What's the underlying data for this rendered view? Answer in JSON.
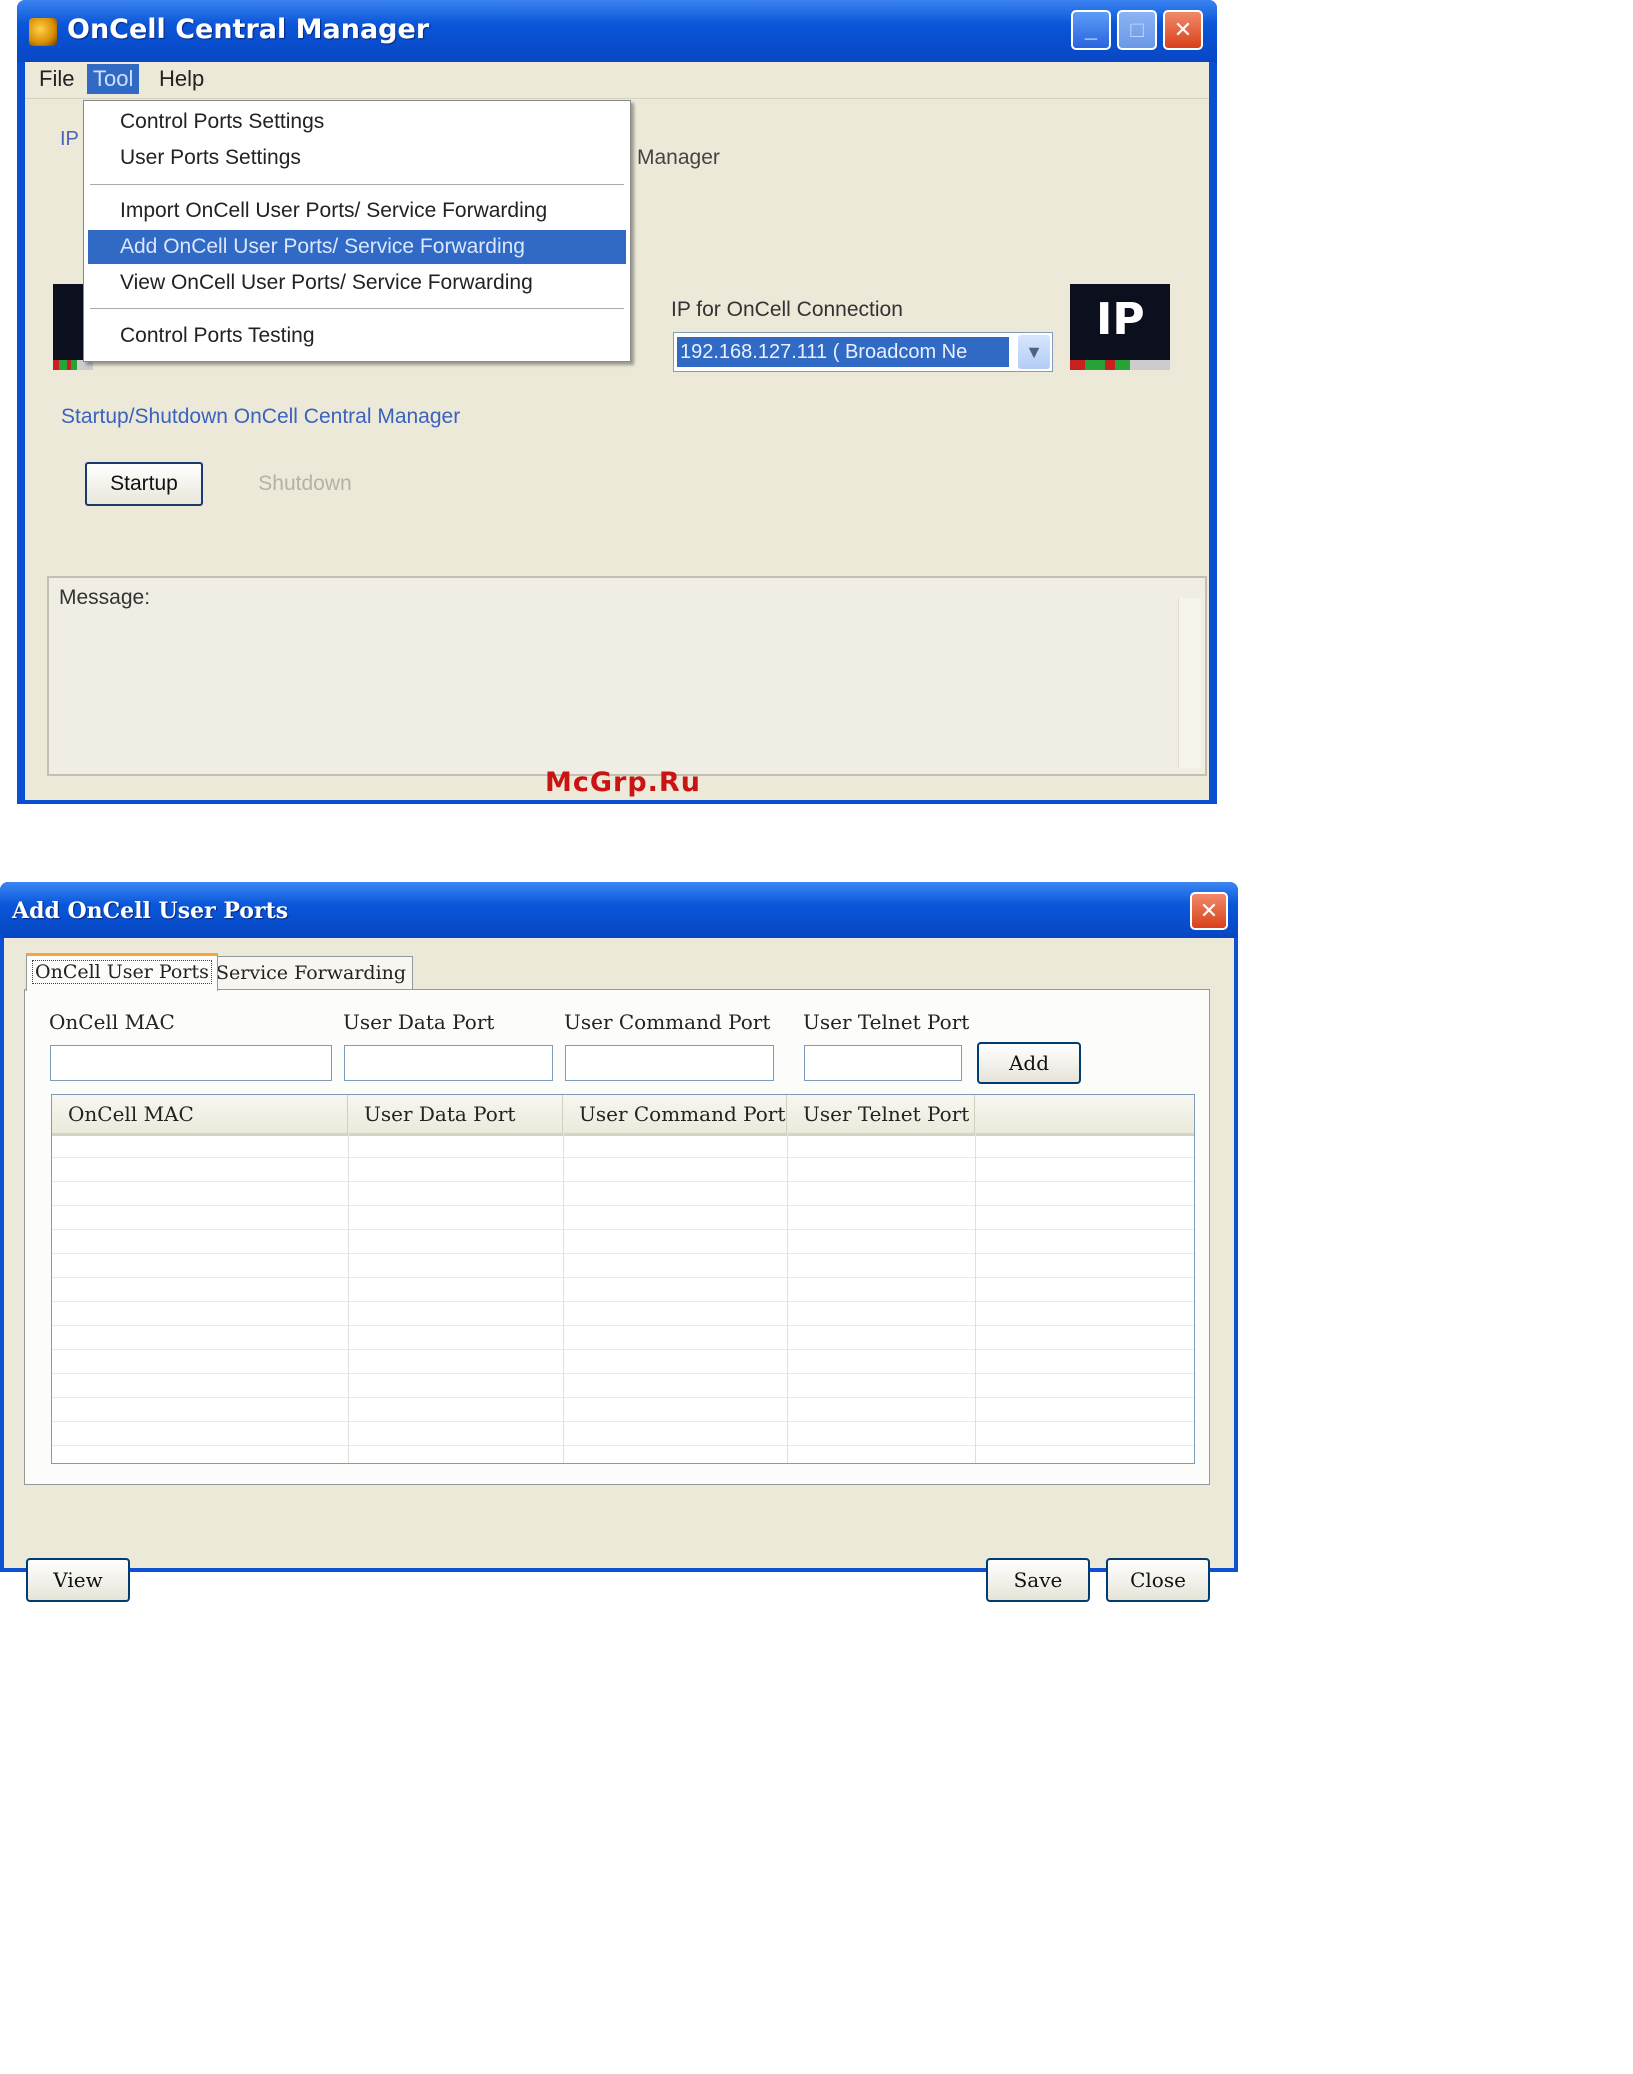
{
  "main_window": {
    "title": "OnCell Central Manager",
    "caption_buttons": {
      "minimize": "_",
      "maximize": "□",
      "close": "✕"
    },
    "menu": [
      "File",
      "Tool",
      "Help"
    ],
    "active_menu": "Tool",
    "dropdown": [
      "Control Ports Settings",
      "User Ports Settings",
      "Import OnCell User Ports/ Service Forwarding",
      "Add OnCell User Ports/ Service Forwarding",
      "View OnCell User Ports/ Service Forwarding",
      "Control Ports Testing"
    ],
    "highlighted_item": "Add OnCell User Ports/ Service Forwarding",
    "partial_label_left": "IP",
    "partial_label_right": "Manager",
    "ip_connection_label": "IP for OnCell Connection",
    "ip_connection_value": "192.168.127.111 ( Broadcom Ne",
    "ip_graphic_text": "IP",
    "startup_section_label": "Startup/Shutdown OnCell Central Manager",
    "startup_button": "Startup",
    "shutdown_button": "Shutdown",
    "message_label": "Message:"
  },
  "watermark": "McGrp.Ru",
  "add_dialog": {
    "title": "Add OnCell User Ports",
    "tabs": [
      "OnCell User Ports",
      "Service Forwarding"
    ],
    "active_tab": "OnCell User Ports",
    "fields": {
      "mac_label": "OnCell MAC",
      "data_port_label": "User Data Port",
      "command_port_label": "User Command Port",
      "telnet_port_label": "User Telnet Port",
      "mac_value": "",
      "data_port_value": "",
      "command_port_value": "",
      "telnet_port_value": ""
    },
    "add_button": "Add",
    "table": {
      "columns": [
        "OnCell MAC",
        "User Data Port",
        "User Command Port",
        "User Telnet Port",
        ""
      ],
      "rows": []
    },
    "buttons": {
      "view": "View",
      "save": "Save",
      "close": "Close"
    }
  }
}
